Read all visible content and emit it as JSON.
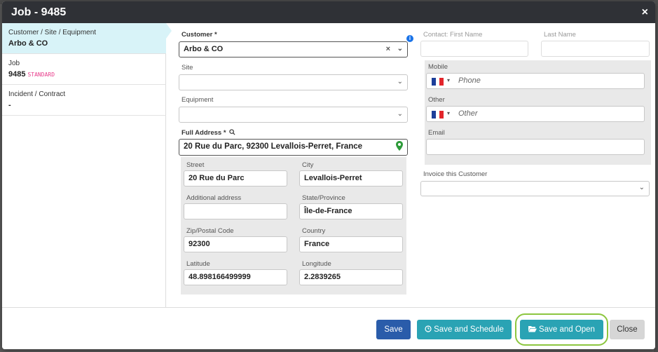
{
  "modal": {
    "title": "Job - 9485",
    "close_symbol": "×"
  },
  "sidebar": {
    "items": [
      {
        "label": "Customer / Site / Equipment",
        "value": "Arbo & CO"
      },
      {
        "label": "Job",
        "value": "9485",
        "badge": "STANDARD"
      },
      {
        "label": "Incident / Contract",
        "value": "-"
      }
    ]
  },
  "form": {
    "customer_label": "Customer *",
    "customer_value": "Arbo & CO",
    "site_label": "Site",
    "site_value": "",
    "equipment_label": "Equipment",
    "equipment_value": "",
    "full_address_label": "Full Address *",
    "full_address_value": "20 Rue du Parc, 92300 Levallois-Perret, France",
    "street_label": "Street",
    "street_value": "20 Rue du Parc",
    "city_label": "City",
    "city_value": "Levallois-Perret",
    "additional_label": "Additional address",
    "additional_value": "",
    "state_label": "State/Province",
    "state_value": "Île-de-France",
    "zip_label": "Zip/Postal Code",
    "zip_value": "92300",
    "country_label": "Country",
    "country_value": "France",
    "lat_label": "Latitude",
    "lat_value": "48.898166499999",
    "lng_label": "Longitude",
    "lng_value": "2.2839265"
  },
  "contact": {
    "first_name_label": "Contact: First Name",
    "last_name_label": "Last Name",
    "mobile_label": "Mobile",
    "mobile_placeholder": "Phone",
    "other_label": "Other",
    "other_placeholder": "Other",
    "email_label": "Email",
    "invoice_label": "Invoice this Customer"
  },
  "footer": {
    "save_label": "Save",
    "save_schedule_label": "Save and Schedule",
    "save_open_label": "Save and Open",
    "close_label": "Close"
  },
  "icons": {
    "info": "info-icon",
    "search": "search-icon",
    "map_pin": "map-pin-icon",
    "clock": "clock-icon",
    "folder": "folder-open-icon",
    "chevron": "chevron-down-icon",
    "clear": "clear-icon",
    "flag": "france-flag-icon"
  },
  "colors": {
    "header_bg": "#2f3136",
    "active_sidebar": "#d8f3f8",
    "primary": "#2a5caa",
    "teal": "#2aa3b4",
    "highlight": "#8cc63f",
    "badge": "#e83e8c"
  }
}
